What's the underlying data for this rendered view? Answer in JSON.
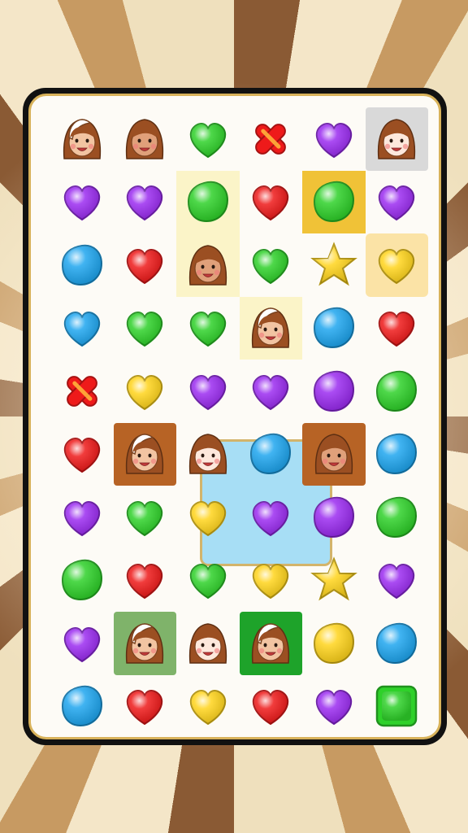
{
  "colors": {
    "purple": "#9b2cf0",
    "green": "#2fd12a",
    "red": "#ee1a1a",
    "blue": "#1fa6ef",
    "yellow": "#ffd41c",
    "board_border": "#d8b25a",
    "special_zone": "#a7def5"
  },
  "board": {
    "rows": 10,
    "cols": 6,
    "cells": [
      [
        {
          "t": "face",
          "v": "hood"
        },
        {
          "t": "face",
          "v": "dark"
        },
        {
          "t": "heart",
          "c": "green"
        },
        {
          "t": "cross",
          "c": "red"
        },
        {
          "t": "heart",
          "c": "purple"
        },
        {
          "t": "face",
          "v": "light",
          "hl": "grey"
        }
      ],
      [
        {
          "t": "heart",
          "c": "purple"
        },
        {
          "t": "heart",
          "c": "purple"
        },
        {
          "t": "blob",
          "c": "green",
          "hl": "lightyellow"
        },
        {
          "t": "heart",
          "c": "red"
        },
        {
          "t": "blob",
          "c": "green",
          "hl": "gold"
        },
        {
          "t": "heart",
          "c": "purple"
        }
      ],
      [
        {
          "t": "blob",
          "c": "blue"
        },
        {
          "t": "heart",
          "c": "red"
        },
        {
          "t": "face",
          "v": "dark",
          "hl": "lightyellow"
        },
        {
          "t": "heart",
          "c": "green"
        },
        {
          "t": "star",
          "c": "yellow"
        },
        {
          "t": "heart",
          "c": "yellow",
          "hl": "paleorange"
        }
      ],
      [
        {
          "t": "heart",
          "c": "blue"
        },
        {
          "t": "heart",
          "c": "green"
        },
        {
          "t": "heart",
          "c": "green"
        },
        {
          "t": "face",
          "v": "hood",
          "hl": "lightyellow"
        },
        {
          "t": "blob",
          "c": "blue"
        },
        {
          "t": "heart",
          "c": "red"
        }
      ],
      [
        {
          "t": "cross",
          "c": "red"
        },
        {
          "t": "heart",
          "c": "yellow"
        },
        {
          "t": "heart",
          "c": "purple"
        },
        {
          "t": "heart",
          "c": "purple"
        },
        {
          "t": "blob",
          "c": "purple"
        },
        {
          "t": "blob",
          "c": "green"
        }
      ],
      [
        {
          "t": "heart",
          "c": "red"
        },
        {
          "t": "face",
          "v": "hood",
          "hl": "brown"
        },
        {
          "t": "face",
          "v": "light"
        },
        {
          "t": "blob",
          "c": "blue"
        },
        {
          "t": "face",
          "v": "dark",
          "hl": "brown"
        },
        {
          "t": "blob",
          "c": "blue"
        }
      ],
      [
        {
          "t": "heart",
          "c": "purple"
        },
        {
          "t": "heart",
          "c": "green"
        },
        {
          "t": "heart",
          "c": "yellow"
        },
        {
          "t": "heart",
          "c": "purple"
        },
        {
          "t": "blob",
          "c": "purple"
        },
        {
          "t": "blob",
          "c": "green"
        }
      ],
      [
        {
          "t": "blob",
          "c": "green"
        },
        {
          "t": "heart",
          "c": "red"
        },
        {
          "t": "heart",
          "c": "green"
        },
        {
          "t": "heart",
          "c": "yellow"
        },
        {
          "t": "star",
          "c": "yellow"
        },
        {
          "t": "heart",
          "c": "purple"
        }
      ],
      [
        {
          "t": "heart",
          "c": "purple"
        },
        {
          "t": "face",
          "v": "hood",
          "hl": "greenish"
        },
        {
          "t": "face",
          "v": "light"
        },
        {
          "t": "face",
          "v": "hood",
          "hl": "green"
        },
        {
          "t": "blob",
          "c": "yellow"
        },
        {
          "t": "blob",
          "c": "blue"
        }
      ],
      [
        {
          "t": "blob",
          "c": "blue"
        },
        {
          "t": "heart",
          "c": "red"
        },
        {
          "t": "heart",
          "c": "yellow"
        },
        {
          "t": "heart",
          "c": "red"
        },
        {
          "t": "heart",
          "c": "purple"
        },
        {
          "t": "square",
          "c": "green"
        }
      ]
    ]
  }
}
